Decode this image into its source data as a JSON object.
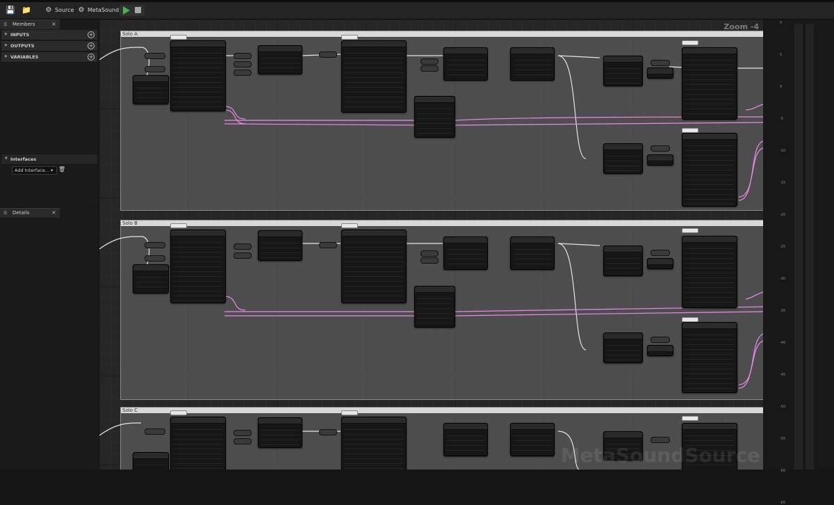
{
  "toolbar": {
    "source_label": "Source",
    "metasound_label": "MetaSound"
  },
  "members_panel": {
    "tab_label": "Members",
    "sections": [
      {
        "label": "INPUTS"
      },
      {
        "label": "OUTPUTS"
      },
      {
        "label": "VARIABLES"
      }
    ]
  },
  "interfaces_panel": {
    "header": "Interfaces",
    "add_label": "Add Interface..."
  },
  "details_panel": {
    "tab_label": "Details"
  },
  "graph": {
    "zoom_label": "Zoom -4",
    "watermark": "MetaSoundSource",
    "comments": [
      {
        "label": "Solo A"
      },
      {
        "label": "Solo B"
      },
      {
        "label": "Solo C"
      }
    ]
  },
  "ruler_ticks": [
    "0",
    "5",
    "0",
    "-5",
    "-10",
    "-15",
    "-20",
    "-25",
    "-30",
    "-35",
    "-40",
    "-45",
    "-50",
    "-55",
    "-60",
    "-65"
  ],
  "colors": {
    "accent_green": "#4caf50",
    "wire_pink": "#e98ae8",
    "wire_white": "#e6e6e6",
    "graph_bg": "#262626"
  }
}
